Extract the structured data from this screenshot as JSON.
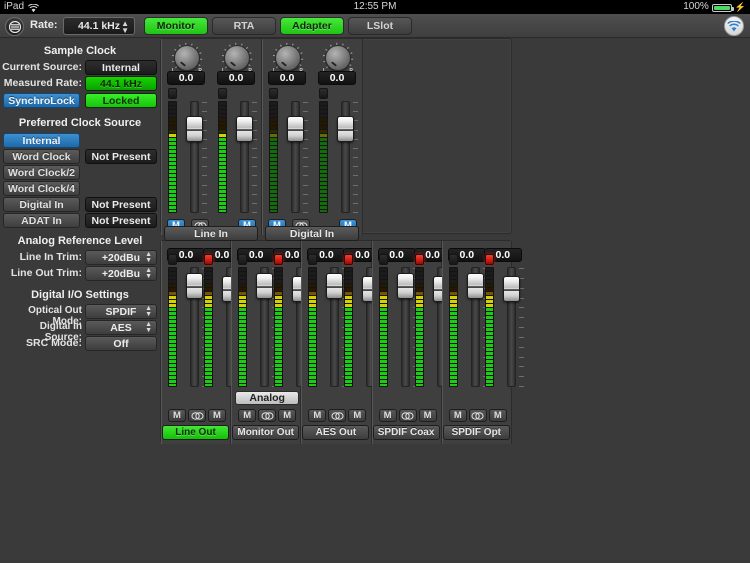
{
  "statusbar": {
    "device": "iPad",
    "wifi_icon": "wifi-icon",
    "time": "12:55 PM",
    "battery_percent": "100%",
    "charging_icon": "lightning-bolt-icon"
  },
  "toolbar": {
    "menu_icon": "hamburger-menu-icon",
    "rate_label": "Rate:",
    "rate_value": "44.1 kHz",
    "tabs": [
      {
        "label": "Monitor",
        "active": true
      },
      {
        "label": "RTA",
        "active": false
      },
      {
        "label": "Adapter",
        "active": true
      },
      {
        "label": "LSlot",
        "active": false
      }
    ],
    "wifi_button_icon": "wifi-icon"
  },
  "sample_clock": {
    "title": "Sample Clock",
    "rows": [
      {
        "label": "Current Source:",
        "value": "Internal",
        "style": "dark"
      },
      {
        "label": "Measured Rate:",
        "value": "44.1 kHz",
        "style": "green"
      }
    ],
    "synchrolock": {
      "label": "SynchroLock",
      "value": "Locked"
    }
  },
  "preferred_clock_source": {
    "title": "Preferred Clock Source",
    "items": [
      {
        "label": "Internal",
        "selected": true,
        "status": ""
      },
      {
        "label": "Word Clock",
        "selected": false,
        "status": "Not Present"
      },
      {
        "label": "Word Clock/2",
        "selected": false,
        "status": ""
      },
      {
        "label": "Word Clock/4",
        "selected": false,
        "status": ""
      },
      {
        "label": "Digital In",
        "selected": false,
        "status": "Not Present"
      },
      {
        "label": "ADAT In",
        "selected": false,
        "status": "Not Present"
      }
    ]
  },
  "analog_reference_level": {
    "title": "Analog Reference Level",
    "rows": [
      {
        "label": "Line In Trim:",
        "value": "+20dBu"
      },
      {
        "label": "Line Out Trim:",
        "value": "+20dBu"
      }
    ]
  },
  "digital_io_settings": {
    "title": "Digital I/O Settings",
    "rows": [
      {
        "label": "Optical Out Mode:",
        "value": "SPDIF",
        "popup": true
      },
      {
        "label": "Digital In Source:",
        "value": "AES",
        "popup": true
      },
      {
        "label": "SRC Mode:",
        "value": "Off",
        "popup": false
      }
    ]
  },
  "mixer": {
    "mute_label": "M",
    "link_icon": "stereo-link-icon",
    "inputs": [
      {
        "name": "Line In",
        "name_active": false,
        "source_button": null,
        "channels": [
          {
            "pan": "0.0",
            "meter_level": 0.7,
            "meter_style": "bright",
            "clip": false,
            "fader_pos": 0.18,
            "mute": true
          },
          {
            "pan": "0.0",
            "meter_level": 0.7,
            "meter_style": "bright",
            "clip": false,
            "fader_pos": 0.18,
            "mute": true
          }
        ]
      },
      {
        "name": "Digital In",
        "name_active": false,
        "source_button": null,
        "channels": [
          {
            "pan": "0.0",
            "meter_level": 0.7,
            "meter_style": "dim",
            "clip": false,
            "fader_pos": 0.18,
            "mute": true
          },
          {
            "pan": "0.0",
            "meter_level": 0.7,
            "meter_style": "dim",
            "clip": false,
            "fader_pos": 0.18,
            "mute": true
          }
        ]
      }
    ],
    "outputs": [
      {
        "name": "Line Out",
        "name_active": true,
        "source_button": null,
        "channels": [
          {
            "gain": "0.0",
            "meter_level": 0.8,
            "meter_style": "bright",
            "clip": false,
            "fader_pos": 0.06,
            "mute": false
          },
          {
            "gain": "0.0",
            "meter_level": 0.8,
            "meter_style": "bright",
            "clip": true,
            "fader_pos": 0.1,
            "mute": false
          }
        ]
      },
      {
        "name": "Monitor Out",
        "name_active": false,
        "source_button": "Analog",
        "channels": [
          {
            "gain": "0.0",
            "meter_level": 0.8,
            "meter_style": "bright",
            "clip": false,
            "fader_pos": 0.06,
            "mute": false
          },
          {
            "gain": "0.0",
            "meter_level": 0.8,
            "meter_style": "bright",
            "clip": true,
            "fader_pos": 0.1,
            "mute": false
          }
        ]
      },
      {
        "name": "AES Out",
        "name_active": false,
        "source_button": null,
        "channels": [
          {
            "gain": "0.0",
            "meter_level": 0.8,
            "meter_style": "bright",
            "clip": false,
            "fader_pos": 0.06,
            "mute": false
          },
          {
            "gain": "0.0",
            "meter_level": 0.8,
            "meter_style": "bright",
            "clip": true,
            "fader_pos": 0.1,
            "mute": false
          }
        ]
      },
      {
        "name": "SPDIF Coax",
        "name_active": false,
        "source_button": null,
        "channels": [
          {
            "gain": "0.0",
            "meter_level": 0.8,
            "meter_style": "bright",
            "clip": false,
            "fader_pos": 0.06,
            "mute": false
          },
          {
            "gain": "0.0",
            "meter_level": 0.8,
            "meter_style": "bright",
            "clip": true,
            "fader_pos": 0.1,
            "mute": false
          }
        ]
      },
      {
        "name": "SPDIF Opt",
        "name_active": false,
        "source_button": null,
        "channels": [
          {
            "gain": "0.0",
            "meter_level": 0.8,
            "meter_style": "bright",
            "clip": false,
            "fader_pos": 0.06,
            "mute": false
          },
          {
            "gain": "0.0",
            "meter_level": 0.8,
            "meter_style": "bright",
            "clip": true,
            "fader_pos": 0.1,
            "mute": false
          }
        ]
      }
    ]
  },
  "colors": {
    "accent_green": "#18d400",
    "accent_blue": "#2f80c4",
    "clip_red": "#ff3b30",
    "panel_bg": "#3a3a3a"
  }
}
